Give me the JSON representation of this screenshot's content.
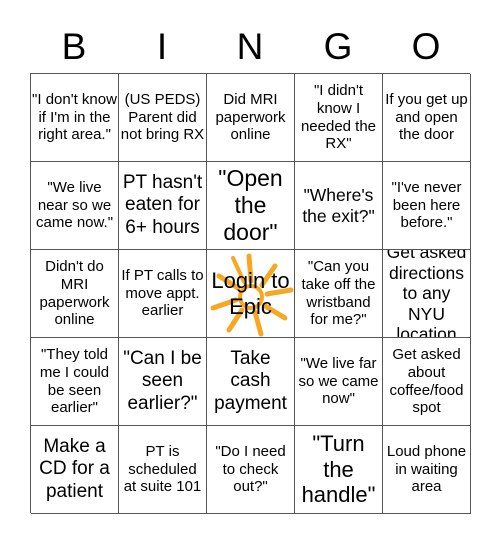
{
  "header": {
    "letters": [
      "B",
      "I",
      "N",
      "G",
      "O"
    ]
  },
  "free_space": {
    "label": "Login to Epic",
    "icon": "sun-icon",
    "icon_color": "#F7A823"
  },
  "grid": {
    "rows": [
      [
        "\"I don't know if I'm in the right area.\"",
        "(US PEDS) Parent did not bring RX",
        "Did MRI paperwork online",
        "\"I didn't know I needed the RX\"",
        "If you get up and open the door"
      ],
      [
        "\"We live near so we came now.\"",
        "PT hasn't eaten for 6+ hours",
        "\"Open the door\"",
        "\"Where's the exit?\"",
        "\"I've never been here before.\""
      ],
      [
        "Didn't do MRI paperwork online",
        "If PT calls to move appt. earlier",
        "Login to Epic",
        "\"Can you take off the wristband for me?\"",
        "Get asked directions to any NYU location"
      ],
      [
        "\"They told me I could be seen earlier\"",
        "\"Can I be seen earlier?\"",
        "Take cash payment",
        "\"We live far so we came now\"",
        "Get asked about coffee/food spot"
      ],
      [
        "Make a CD for a patient",
        "PT is scheduled at suite 101",
        "\"Do I need to check out?\"",
        "\"Turn the handle\"",
        "Loud phone in waiting area"
      ]
    ]
  }
}
